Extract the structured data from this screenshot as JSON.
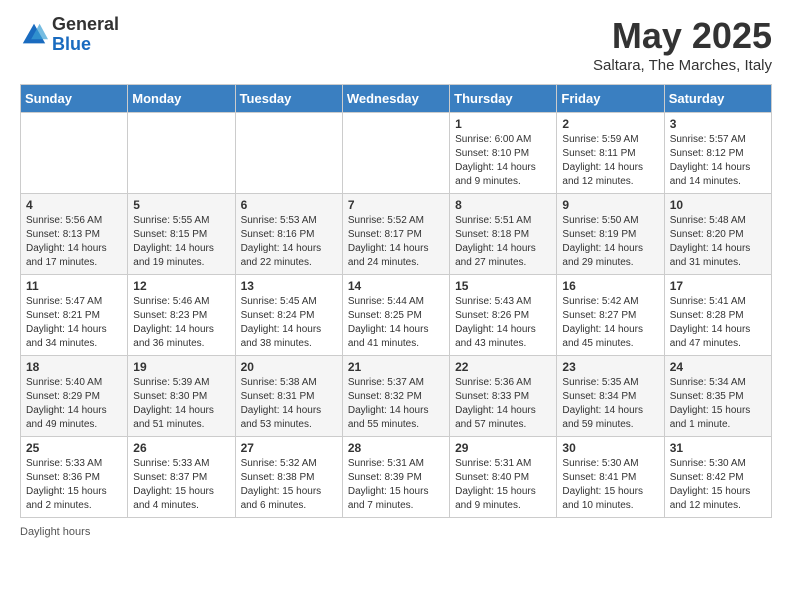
{
  "logo": {
    "general": "General",
    "blue": "Blue",
    "icon_color": "#1a6bbf"
  },
  "header": {
    "month_title": "May 2025",
    "subtitle": "Saltara, The Marches, Italy"
  },
  "days_of_week": [
    "Sunday",
    "Monday",
    "Tuesday",
    "Wednesday",
    "Thursday",
    "Friday",
    "Saturday"
  ],
  "weeks": [
    [
      {
        "day": "",
        "info": ""
      },
      {
        "day": "",
        "info": ""
      },
      {
        "day": "",
        "info": ""
      },
      {
        "day": "",
        "info": ""
      },
      {
        "day": "1",
        "info": "Sunrise: 6:00 AM\nSunset: 8:10 PM\nDaylight: 14 hours\nand 9 minutes."
      },
      {
        "day": "2",
        "info": "Sunrise: 5:59 AM\nSunset: 8:11 PM\nDaylight: 14 hours\nand 12 minutes."
      },
      {
        "day": "3",
        "info": "Sunrise: 5:57 AM\nSunset: 8:12 PM\nDaylight: 14 hours\nand 14 minutes."
      }
    ],
    [
      {
        "day": "4",
        "info": "Sunrise: 5:56 AM\nSunset: 8:13 PM\nDaylight: 14 hours\nand 17 minutes."
      },
      {
        "day": "5",
        "info": "Sunrise: 5:55 AM\nSunset: 8:15 PM\nDaylight: 14 hours\nand 19 minutes."
      },
      {
        "day": "6",
        "info": "Sunrise: 5:53 AM\nSunset: 8:16 PM\nDaylight: 14 hours\nand 22 minutes."
      },
      {
        "day": "7",
        "info": "Sunrise: 5:52 AM\nSunset: 8:17 PM\nDaylight: 14 hours\nand 24 minutes."
      },
      {
        "day": "8",
        "info": "Sunrise: 5:51 AM\nSunset: 8:18 PM\nDaylight: 14 hours\nand 27 minutes."
      },
      {
        "day": "9",
        "info": "Sunrise: 5:50 AM\nSunset: 8:19 PM\nDaylight: 14 hours\nand 29 minutes."
      },
      {
        "day": "10",
        "info": "Sunrise: 5:48 AM\nSunset: 8:20 PM\nDaylight: 14 hours\nand 31 minutes."
      }
    ],
    [
      {
        "day": "11",
        "info": "Sunrise: 5:47 AM\nSunset: 8:21 PM\nDaylight: 14 hours\nand 34 minutes."
      },
      {
        "day": "12",
        "info": "Sunrise: 5:46 AM\nSunset: 8:23 PM\nDaylight: 14 hours\nand 36 minutes."
      },
      {
        "day": "13",
        "info": "Sunrise: 5:45 AM\nSunset: 8:24 PM\nDaylight: 14 hours\nand 38 minutes."
      },
      {
        "day": "14",
        "info": "Sunrise: 5:44 AM\nSunset: 8:25 PM\nDaylight: 14 hours\nand 41 minutes."
      },
      {
        "day": "15",
        "info": "Sunrise: 5:43 AM\nSunset: 8:26 PM\nDaylight: 14 hours\nand 43 minutes."
      },
      {
        "day": "16",
        "info": "Sunrise: 5:42 AM\nSunset: 8:27 PM\nDaylight: 14 hours\nand 45 minutes."
      },
      {
        "day": "17",
        "info": "Sunrise: 5:41 AM\nSunset: 8:28 PM\nDaylight: 14 hours\nand 47 minutes."
      }
    ],
    [
      {
        "day": "18",
        "info": "Sunrise: 5:40 AM\nSunset: 8:29 PM\nDaylight: 14 hours\nand 49 minutes."
      },
      {
        "day": "19",
        "info": "Sunrise: 5:39 AM\nSunset: 8:30 PM\nDaylight: 14 hours\nand 51 minutes."
      },
      {
        "day": "20",
        "info": "Sunrise: 5:38 AM\nSunset: 8:31 PM\nDaylight: 14 hours\nand 53 minutes."
      },
      {
        "day": "21",
        "info": "Sunrise: 5:37 AM\nSunset: 8:32 PM\nDaylight: 14 hours\nand 55 minutes."
      },
      {
        "day": "22",
        "info": "Sunrise: 5:36 AM\nSunset: 8:33 PM\nDaylight: 14 hours\nand 57 minutes."
      },
      {
        "day": "23",
        "info": "Sunrise: 5:35 AM\nSunset: 8:34 PM\nDaylight: 14 hours\nand 59 minutes."
      },
      {
        "day": "24",
        "info": "Sunrise: 5:34 AM\nSunset: 8:35 PM\nDaylight: 15 hours\nand 1 minute."
      }
    ],
    [
      {
        "day": "25",
        "info": "Sunrise: 5:33 AM\nSunset: 8:36 PM\nDaylight: 15 hours\nand 2 minutes."
      },
      {
        "day": "26",
        "info": "Sunrise: 5:33 AM\nSunset: 8:37 PM\nDaylight: 15 hours\nand 4 minutes."
      },
      {
        "day": "27",
        "info": "Sunrise: 5:32 AM\nSunset: 8:38 PM\nDaylight: 15 hours\nand 6 minutes."
      },
      {
        "day": "28",
        "info": "Sunrise: 5:31 AM\nSunset: 8:39 PM\nDaylight: 15 hours\nand 7 minutes."
      },
      {
        "day": "29",
        "info": "Sunrise: 5:31 AM\nSunset: 8:40 PM\nDaylight: 15 hours\nand 9 minutes."
      },
      {
        "day": "30",
        "info": "Sunrise: 5:30 AM\nSunset: 8:41 PM\nDaylight: 15 hours\nand 10 minutes."
      },
      {
        "day": "31",
        "info": "Sunrise: 5:30 AM\nSunset: 8:42 PM\nDaylight: 15 hours\nand 12 minutes."
      }
    ]
  ],
  "footer": {
    "label": "Daylight hours"
  }
}
